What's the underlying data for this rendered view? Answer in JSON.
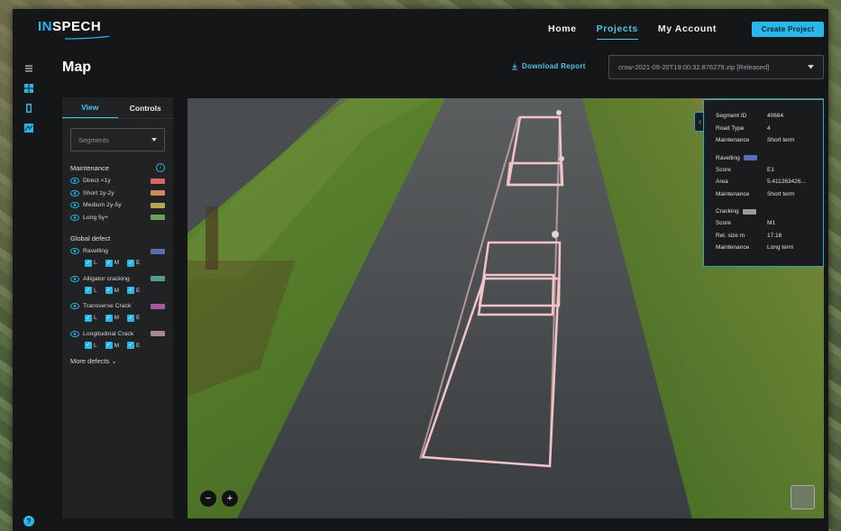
{
  "brand": {
    "name_part1": "IN",
    "name_part2": "SPECH"
  },
  "nav": {
    "items": [
      {
        "label": "Home",
        "active": false
      },
      {
        "label": "Projects",
        "active": true
      },
      {
        "label": "My Account",
        "active": false
      }
    ]
  },
  "header": {
    "create_button": "Create Project"
  },
  "rail": {
    "icons": [
      "menu-icon",
      "dashboard-icon",
      "layers-icon",
      "map-icon"
    ],
    "help": "?"
  },
  "page": {
    "title": "Map",
    "download_label": "Download Report",
    "release_value": "crow-2021-09-20T19:00:32.876279.zip [Released]"
  },
  "panel": {
    "tabs": {
      "view": "View",
      "controls": "Controls"
    },
    "segments_placeholder": "Segments",
    "maintenance": {
      "title": "Maintenance",
      "items": [
        {
          "label": "Direct <1y",
          "color": "#d9646a"
        },
        {
          "label": "Short 1y-2y",
          "color": "#c98a55"
        },
        {
          "label": "Medium 2y-5y",
          "color": "#b8a452"
        },
        {
          "label": "Long 5y+",
          "color": "#6fa05a"
        }
      ]
    },
    "global_defect": {
      "title": "Global defect",
      "check_labels": {
        "l": "L",
        "m": "M",
        "e": "E"
      },
      "items": [
        {
          "label": "Ravelling",
          "color": "#5b6cb0"
        },
        {
          "label": "Alligator cracking",
          "color": "#5a9a8a"
        },
        {
          "label": "Transverse Crack",
          "color": "#a45aa0"
        },
        {
          "label": "Longitudinal Crack",
          "color": "#a08c8c"
        }
      ]
    },
    "more_defects": "More defects"
  },
  "popup": {
    "segment_id_label": "Segment ID",
    "segment_id": "40684",
    "road_type_label": "Road Type",
    "road_type": "4",
    "maintenance_label": "Maintenance",
    "maintenance": "Short term",
    "ravelling": {
      "title": "Ravelling",
      "color": "#5b6cb0",
      "score_label": "Score",
      "score": "E1",
      "area_label": "Area",
      "area": "5.411263426...",
      "maintenance_label": "Maintenance",
      "maintenance": "Short term"
    },
    "cracking": {
      "title": "Cracking",
      "color": "#9a9a9a",
      "score_label": "Score",
      "score": "M1",
      "rel_size_label": "Rel. size m",
      "rel_size": "17.16",
      "maintenance_label": "Maintenance",
      "maintenance": "Long term"
    }
  },
  "map": {
    "zoom_out": "−",
    "zoom_in": "+"
  }
}
